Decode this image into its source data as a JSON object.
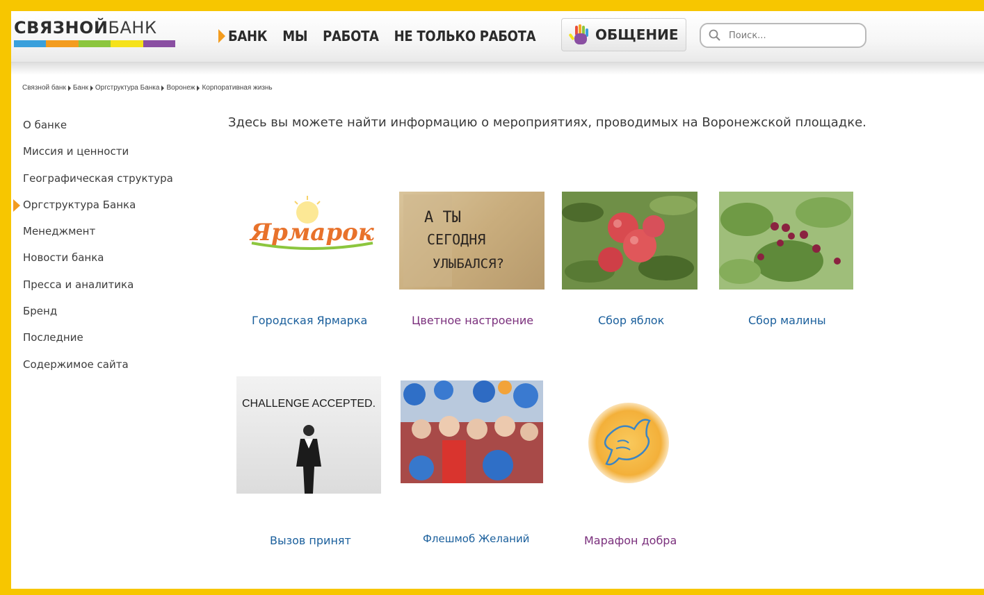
{
  "logo": {
    "part1": "СВЯЗНОЙ",
    "part2": "БАНК",
    "stripe_colors": [
      "#3aa0dc",
      "#f39c1f",
      "#8cc63e",
      "#f5e21b",
      "#8a4fa2"
    ]
  },
  "nav": {
    "items": [
      "БАНК",
      "МЫ",
      "РАБОТА",
      "НЕ ТОЛЬКО РАБОТА"
    ],
    "button_label": "ОБЩЕНИЕ",
    "accent": "#f39c1f"
  },
  "search": {
    "placeholder": "Поиск..."
  },
  "breadcrumb": [
    "Связной банк",
    "Банк",
    "Оргструктура Банка",
    "Воронеж",
    "Корпоративная жизнь"
  ],
  "sidebar": {
    "items": [
      {
        "label": "О банке",
        "active": false
      },
      {
        "label": "Миссия и ценности",
        "active": false
      },
      {
        "label": "Географическая структура",
        "active": false
      },
      {
        "label": "Оргструктура Банка",
        "active": true
      },
      {
        "label": "Менеджмент",
        "active": false
      },
      {
        "label": "Новости банка",
        "active": false
      },
      {
        "label": "Пресса и аналитика",
        "active": false
      },
      {
        "label": "Бренд",
        "active": false
      },
      {
        "label": "Последние",
        "active": false
      },
      {
        "label": "Содержимое сайта",
        "active": false
      }
    ]
  },
  "main": {
    "intro": "Здесь вы можете найти информацию о мероприятиях, проводимых на Воронежской площадке.",
    "tiles": [
      {
        "caption": "Городская Ярмарка",
        "image_text": "Ярмарок"
      },
      {
        "caption": "Цветное настроение",
        "image_text_lines": [
          "А ТЫ",
          "СЕГОДНЯ",
          "УЛЫБАЛСЯ?"
        ]
      },
      {
        "caption": "Сбор яблок"
      },
      {
        "caption": "Сбор малины"
      },
      {
        "caption": "Вызов принят",
        "image_text": "CHALLENGE ACCEPTED."
      },
      {
        "caption": "Флешмоб Желаний"
      },
      {
        "caption": "Марафон добра"
      }
    ]
  }
}
